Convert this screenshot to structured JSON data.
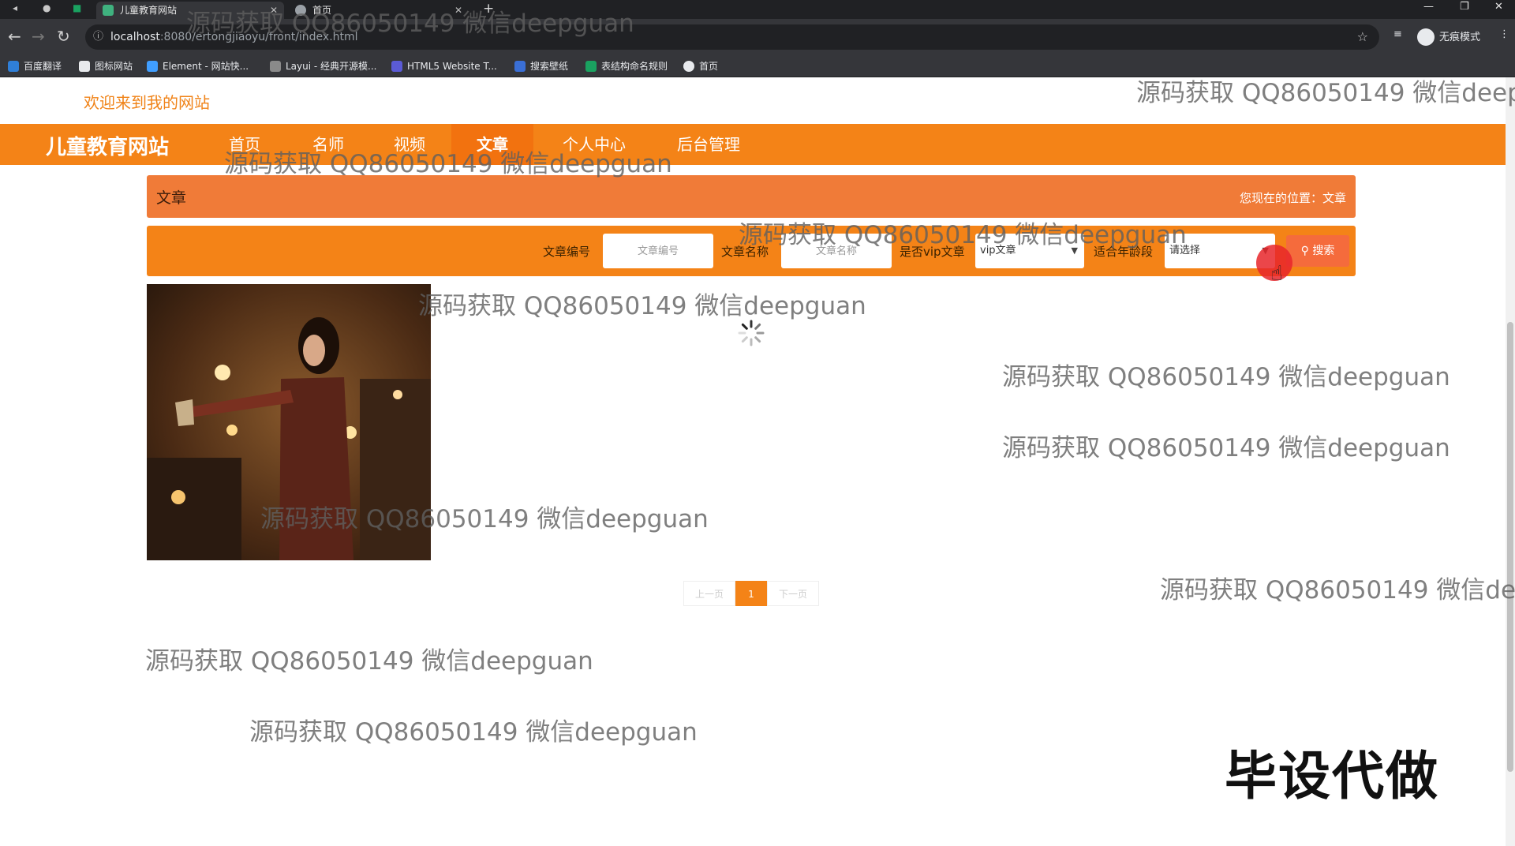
{
  "browser": {
    "tabs": [
      {
        "title": "儿童教育网站",
        "active": true
      },
      {
        "title": "首页",
        "active": false
      }
    ],
    "url_host": "localhost",
    "url_path": ":8080/ertongjiaoyu/front/index.html",
    "profile_label": "无痕模式",
    "bookmarks": [
      "百度翻译",
      "图标网站",
      "Element - 网站快...",
      "Layui - 经典开源模...",
      "HTML5 Website T...",
      "搜索壁纸",
      "表结构命名规则",
      "首页"
    ]
  },
  "site": {
    "welcome": "欢迎来到我的网站",
    "title": "儿童教育网站",
    "nav": [
      "首页",
      "名师",
      "视频",
      "文章",
      "个人中心",
      "后台管理"
    ],
    "active_nav": "文章",
    "accent": "#f48317"
  },
  "breadcrumb": {
    "title": "文章",
    "location_label": "您现在的位置：",
    "location_value": "文章"
  },
  "search": {
    "article_no_label": "文章编号",
    "article_no_placeholder": "文章编号",
    "article_name_label": "文章名称",
    "article_name_placeholder": "文章名称",
    "vip_label": "是否vip文章",
    "vip_value": "vip文章",
    "age_label": "适合年龄段",
    "age_value": "请选择",
    "button": "搜索"
  },
  "pagination": {
    "prev": "上一页",
    "current": "1",
    "next": "下一页"
  },
  "watermark": "源码获取 QQ86050149 微信deepguan",
  "promo": "毕设代做"
}
